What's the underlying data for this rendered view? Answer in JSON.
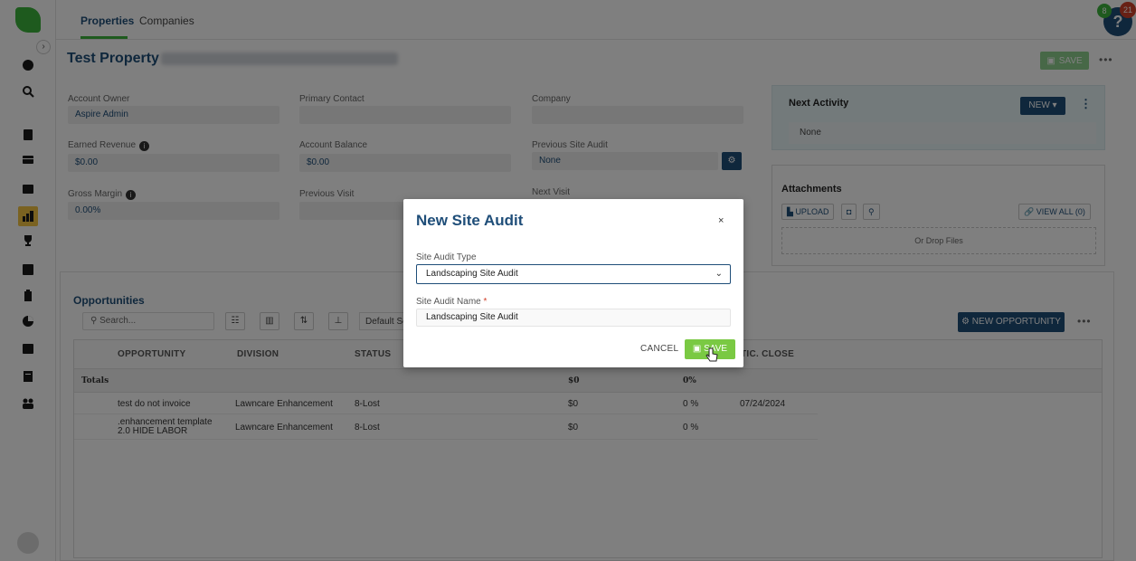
{
  "top_tabs": [
    "Properties",
    "Companies"
  ],
  "notifications": {
    "green": "8",
    "red": "21",
    "help": "?"
  },
  "header": {
    "title": "Test Property",
    "save": "SAVE",
    "more": "•••"
  },
  "fields": {
    "account_owner": {
      "label": "Account Owner",
      "value": "Aspire Admin"
    },
    "primary_contact": {
      "label": "Primary Contact",
      "value": ""
    },
    "company": {
      "label": "Company",
      "value": ""
    },
    "earned_revenue": {
      "label": "Earned Revenue",
      "value": "$0.00"
    },
    "account_balance": {
      "label": "Account Balance",
      "value": "$0.00"
    },
    "previous_site_audit": {
      "label": "Previous Site Audit",
      "value": "None"
    },
    "gross_margin": {
      "label": "Gross Margin",
      "value": "0.00%"
    },
    "previous_visit": {
      "label": "Previous Visit",
      "value": ""
    },
    "next_visit": {
      "label": "Next Visit",
      "value": ""
    }
  },
  "next_activity": {
    "title": "Next Activity",
    "new": "NEW",
    "value": "None"
  },
  "attachments": {
    "title": "Attachments",
    "upload": "UPLOAD",
    "view_all": "VIEW ALL (0)",
    "drop": "Or Drop Files"
  },
  "opportunities": {
    "title": "Opportunities",
    "search_placeholder": "Search...",
    "view": "Default Se",
    "new_button": "NEW OPPORTUNITY",
    "more": "•••",
    "columns": [
      "OPPORTUNITY",
      "DIVISION",
      "STATUS",
      "TIC. CLOSE"
    ],
    "totals": {
      "label": "Totals",
      "amount": "$0",
      "percent": "0%"
    },
    "rows": [
      {
        "name": "test do not invoice",
        "division": "Lawncare Enhancement",
        "status": "8-Lost",
        "amount": "$0",
        "percent": "0 %",
        "date": "07/24/2024"
      },
      {
        "name": ".enhancement template 2.0 HIDE LABOR",
        "division": "Lawncare Enhancement",
        "status": "8-Lost",
        "amount": "$0",
        "percent": "0 %",
        "date": ""
      }
    ]
  },
  "modal": {
    "title": "New Site Audit",
    "close": "×",
    "type_label": "Site Audit Type",
    "type_value": "Landscaping Site Audit",
    "name_label": "Site Audit Name",
    "required_mark": "*",
    "name_value": "Landscaping  Site Audit",
    "cancel": "CANCEL",
    "save": "SAVE"
  },
  "colors": {
    "brand_blue": "#1f4e79",
    "brand_green": "#3cb43c",
    "save_green": "#7ac943"
  }
}
